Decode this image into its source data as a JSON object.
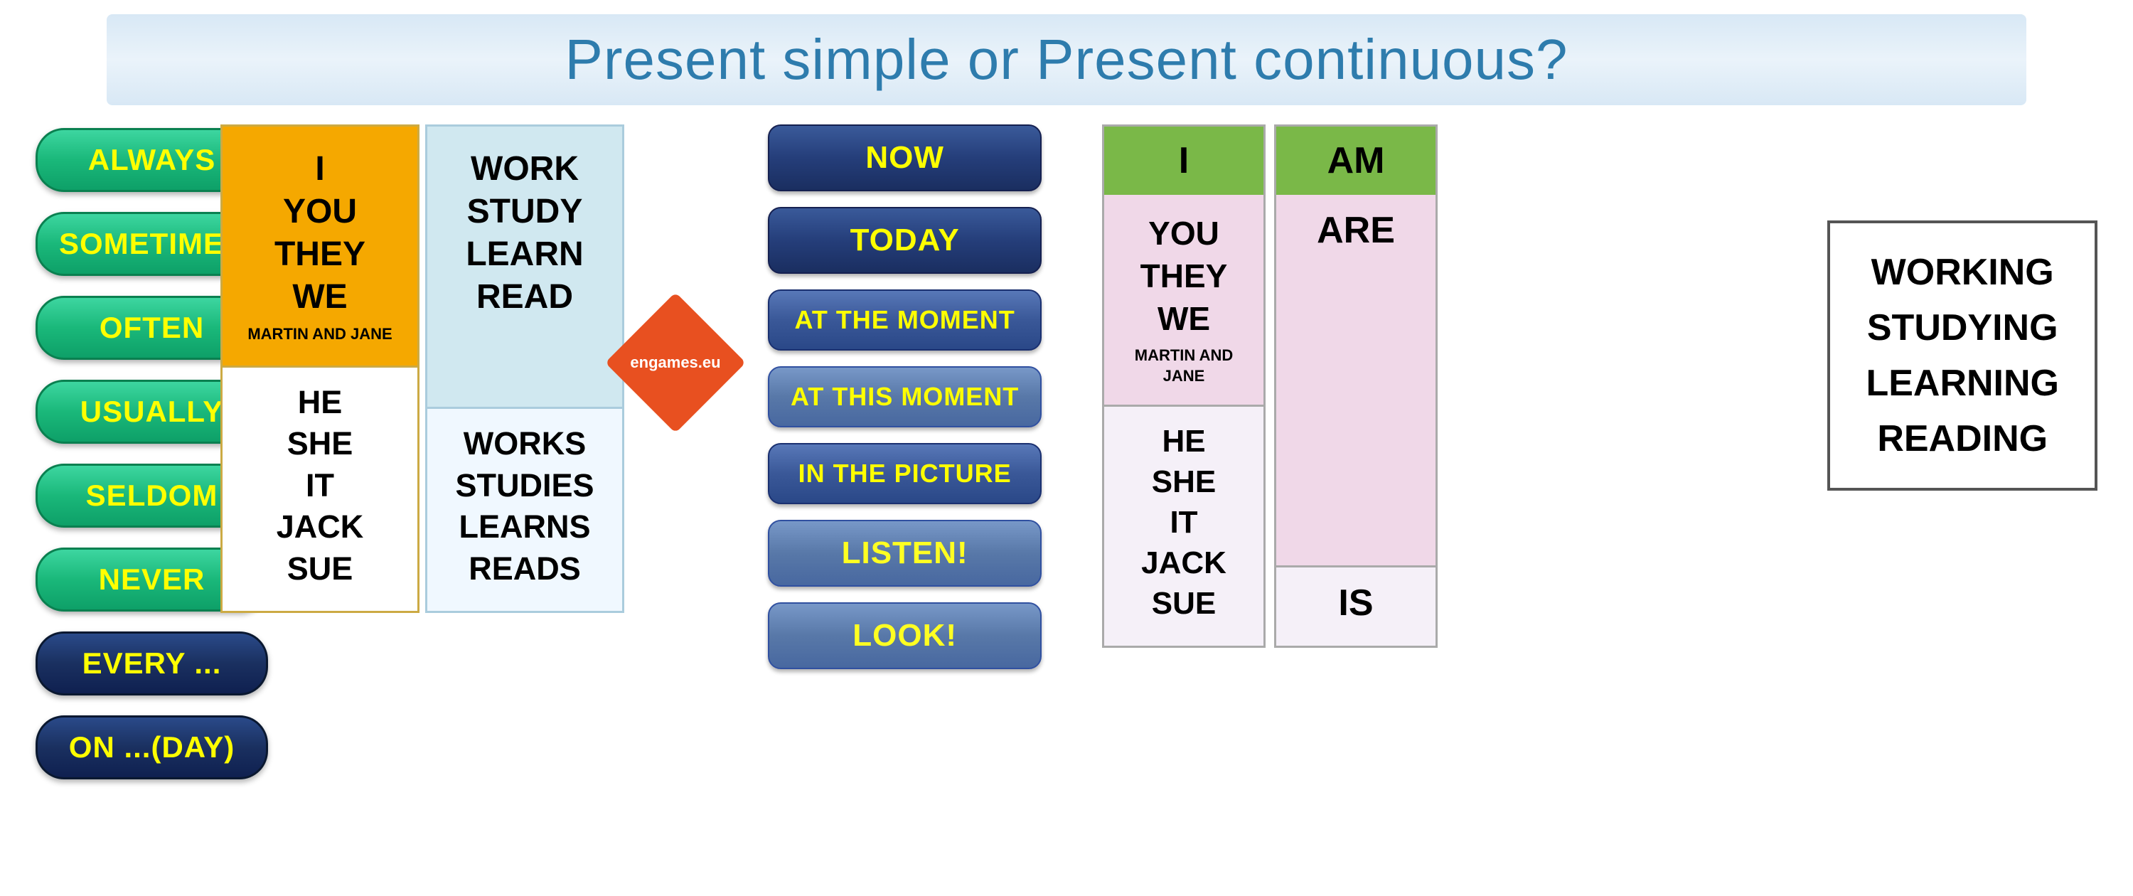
{
  "title": "Present simple or Present continuous?",
  "decorative": {
    "squares": [
      "deco1",
      "deco2",
      "deco3"
    ]
  },
  "left_column": {
    "green_buttons": [
      "ALWAYS",
      "SOMETIMES",
      "OFTEN",
      "USUALLY",
      "SELDOM",
      "NEVER"
    ],
    "dark_buttons": [
      "EVERY ...",
      "ON ...(DAY)"
    ]
  },
  "pronoun_box": {
    "top_pronouns": "I\nYOU\nTHEY\nWE",
    "top_label": "MARTIN AND JANE",
    "bottom_pronouns": "HE\nSHE\nIT\nJACK\nSUE"
  },
  "verb_box": {
    "top_verbs": "WORK\nSTUDY\nLEARN\nREAD",
    "bottom_verbs": "WORKS\nSTUDIES\nLEARNS\nREADS"
  },
  "diamond_text": "engames.eu",
  "time_expressions": {
    "buttons": [
      {
        "text": "NOW",
        "style": "dark"
      },
      {
        "text": "TODAY",
        "style": "dark"
      },
      {
        "text": "AT THE MOMENT",
        "style": "medium"
      },
      {
        "text": "AT THIS MOMENT",
        "style": "light"
      },
      {
        "text": "IN THE PICTURE",
        "style": "medium"
      },
      {
        "text": "LISTEN!",
        "style": "listen"
      },
      {
        "text": "LOOK!",
        "style": "listen"
      }
    ]
  },
  "conjugation": {
    "pronoun_col_header": "I",
    "verb_col_header": "AM",
    "pronoun_top": "YOU\nTHEY\nWE",
    "pronoun_top_label": "MARTIN AND JANE",
    "pronoun_bottom": "HE\nSHE\nIT\nJACK\nSUE",
    "verb_top": "ARE",
    "verb_bottom": "IS"
  },
  "working_box": {
    "lines": [
      "WORKING",
      "STUDYING",
      "LEARNING",
      "READING"
    ]
  }
}
